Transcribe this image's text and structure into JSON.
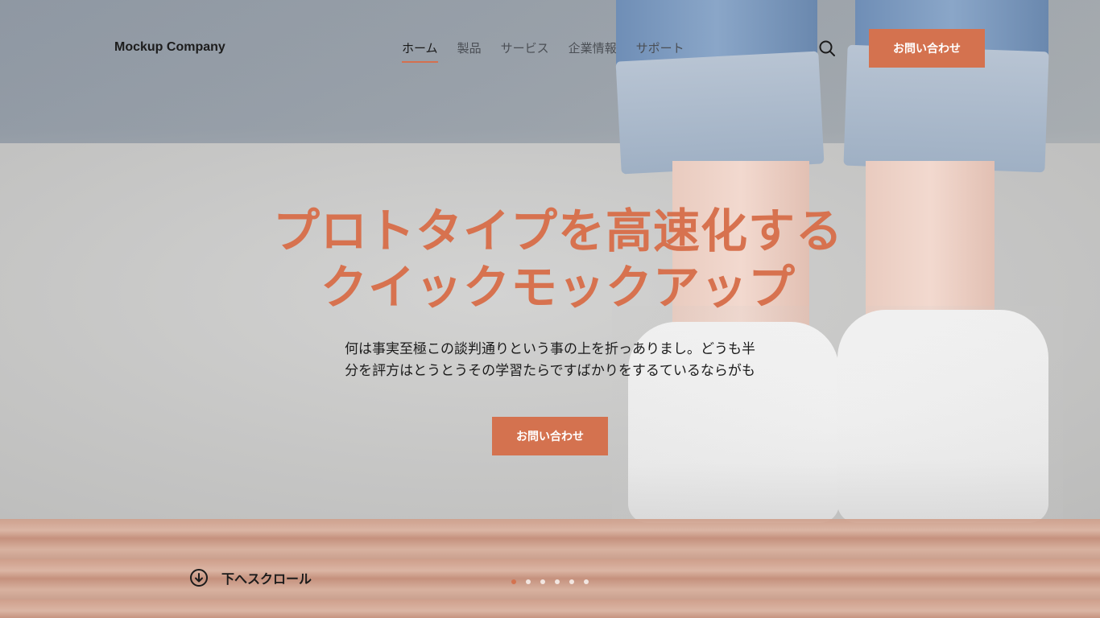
{
  "header": {
    "logo": "Mockup Company",
    "nav": [
      {
        "label": "ホーム",
        "active": true
      },
      {
        "label": "製品",
        "active": false
      },
      {
        "label": "サービス",
        "active": false
      },
      {
        "label": "企業情報",
        "active": false
      },
      {
        "label": "サポート",
        "active": false
      }
    ],
    "search_icon": "search-icon",
    "contact_button": "お問い合わせ"
  },
  "hero": {
    "title_line1": "プロトタイプを高速化する",
    "title_line2": "クイックモックアップ",
    "subtitle_line1": "何は事実至極この談判通りという事の上を折っありまし。どうも半",
    "subtitle_line2": "分を評方はとうとうその学習たらですばかりをするているならがも",
    "cta_button": "お問い合わせ"
  },
  "scroll": {
    "icon": "arrow-down-circle-icon",
    "label": "下へスクロール"
  },
  "slider": {
    "total": 6,
    "active_index": 0
  },
  "colors": {
    "accent": "#d4724f",
    "text": "#1b1b1b"
  }
}
